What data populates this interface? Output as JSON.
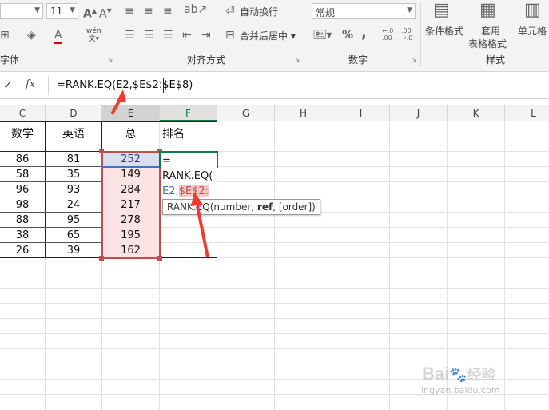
{
  "ribbon": {
    "font_size": "11",
    "wrap_text_label": "自动换行",
    "merge_center_label": "合并后居中",
    "number_format": "常规",
    "conditional_format_label": "条件格式",
    "table_format_line1": "套用",
    "table_format_line2": "表格格式",
    "cell_style_label": "单元格",
    "percent_symbol": "%",
    "comma_symbol": ",",
    "decimal_inc": "←.0\n.00",
    "decimal_dec": ".00\n→.0",
    "group_font": "字体",
    "group_align": "对齐方式",
    "group_number": "数字",
    "group_style": "样式",
    "phonetic_label": "wén",
    "font_color_letter": "A"
  },
  "formula_bar": {
    "fx_label": "fx",
    "formula": "=RANK.EQ(E2,$E$2:$E$8)"
  },
  "columns": [
    "C",
    "D",
    "E",
    "F",
    "G",
    "H",
    "I",
    "J",
    "K",
    "L"
  ],
  "headers": {
    "c": "数学",
    "d": "英语",
    "e": "总",
    "f": "排名"
  },
  "rows": [
    {
      "c": "86",
      "d": "81",
      "e": "252"
    },
    {
      "c": "58",
      "d": "35",
      "e": "149"
    },
    {
      "c": "96",
      "d": "93",
      "e": "284"
    },
    {
      "c": "98",
      "d": "24",
      "e": "217"
    },
    {
      "c": "88",
      "d": "95",
      "e": "278"
    },
    {
      "c": "38",
      "d": "65",
      "e": "195"
    },
    {
      "c": "26",
      "d": "39",
      "e": "162"
    }
  ],
  "edit_cell": {
    "line1": "=",
    "line2": "RANK.EQ(",
    "line3_ref1": "E2,",
    "line3_ref2": "$E$2:"
  },
  "tooltip": {
    "fn": "RANK.EQ(number, ",
    "bold_arg": "ref",
    "rest": ", [order])"
  },
  "watermark": {
    "brand": "Bai",
    "brand2": "经验",
    "url": "jingyan.baidu.com"
  },
  "colors": {
    "selection_fill": "#fbe3e3",
    "selection_border": "#c0504d",
    "ref_blue": "#4472c4",
    "arrow_red": "#f23b2f",
    "excel_green": "#107c41"
  }
}
